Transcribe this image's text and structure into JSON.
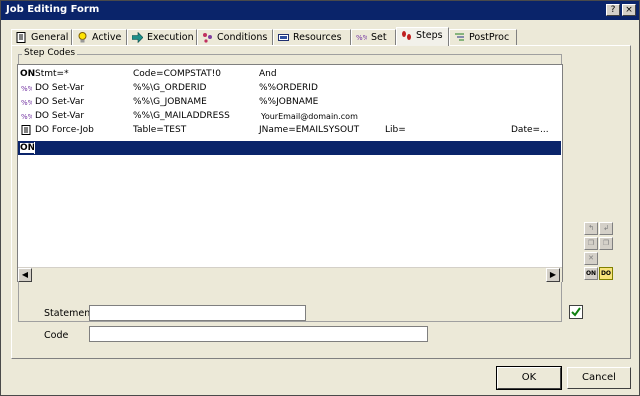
{
  "window": {
    "title": "Job Editing Form",
    "help_glyph": "?",
    "close_glyph": "×"
  },
  "tabs": [
    {
      "label": "General",
      "icon": "document-icon"
    },
    {
      "label": "Active",
      "icon": "lightbulb-icon"
    },
    {
      "label": "Execution",
      "icon": "arrow-right-icon"
    },
    {
      "label": "Conditions",
      "icon": "conditions-icon"
    },
    {
      "label": "Resources",
      "icon": "resources-icon"
    },
    {
      "label": "Set",
      "icon": "set-var-icon"
    },
    {
      "label": "Steps",
      "icon": "footsteps-icon"
    },
    {
      "label": "PostProc",
      "icon": "postproc-icon"
    }
  ],
  "selected_tab": "Steps",
  "step_codes": {
    "group_label": "Step Codes",
    "rows": [
      {
        "icon": "on-label",
        "prefix": "ON",
        "col1": "Stmt=*",
        "col2": "Code=COMPSTAT!0",
        "col3": "And",
        "col4": "",
        "col5": ""
      },
      {
        "icon": "set-var-icon",
        "prefix": "",
        "col1": "DO Set-Var",
        "col2": "%%\\G_ORDERID",
        "col3": "%%ORDERID",
        "col4": "",
        "col5": ""
      },
      {
        "icon": "set-var-icon",
        "prefix": "",
        "col1": "DO Set-Var",
        "col2": "%%\\G_JOBNAME",
        "col3": "%%JOBNAME",
        "col4": "",
        "col5": ""
      },
      {
        "icon": "set-var-icon",
        "prefix": "",
        "col1": "DO Set-Var",
        "col2": "%%\\G_MAILADDRESS",
        "col3": "YourEmail@domain.com",
        "col4": "",
        "col5": ""
      },
      {
        "icon": "document-icon",
        "prefix": "",
        "col1": "DO Force-Job",
        "col2": "Table=TEST",
        "col3": "JName=EMAILSYSOUT",
        "col4": "Lib=",
        "col5": "Date=..."
      },
      {
        "icon": "on-label",
        "prefix": "ON",
        "col1": "",
        "col2": "",
        "col3": "",
        "col4": "",
        "col5": "",
        "selected": true
      }
    ]
  },
  "side_buttons": {
    "on_label": "ON",
    "do_label": "DO"
  },
  "fields": {
    "statement_label": "Statement",
    "statement_value": "",
    "code_label": "Code",
    "code_value": ""
  },
  "buttons": {
    "ok": "OK",
    "cancel": "Cancel"
  },
  "colors": {
    "title_bar": "#0a246a",
    "selection": "#0a246a",
    "window_bg": "#ece9d8"
  }
}
